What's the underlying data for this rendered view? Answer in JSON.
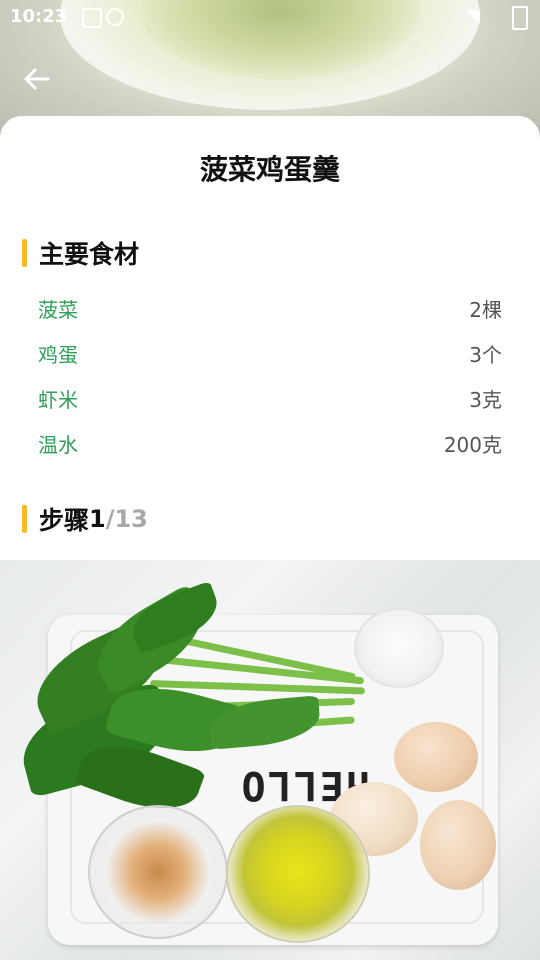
{
  "status_bar": {
    "time": "10:23"
  },
  "recipe": {
    "title": "菠菜鸡蛋羹"
  },
  "ingredients_section": {
    "heading": "主要食材",
    "items": [
      {
        "name": "菠菜",
        "amount": "2棵"
      },
      {
        "name": "鸡蛋",
        "amount": "3个"
      },
      {
        "name": "虾米",
        "amount": "3克"
      },
      {
        "name": "温水",
        "amount": "200克"
      }
    ]
  },
  "steps_section": {
    "heading": "步骤",
    "current": "1",
    "total": "/13"
  },
  "step_photo": {
    "tray_text": "HELLO"
  },
  "colors": {
    "accent_bar": "#f7b924",
    "ingredient_name": "#2f9f5a",
    "amount_text": "#555555",
    "step_total": "#a8a8a8"
  },
  "icons": {
    "back": "arrow-left-icon"
  }
}
